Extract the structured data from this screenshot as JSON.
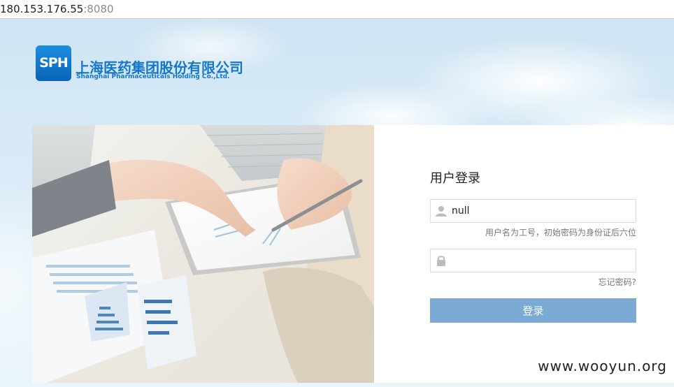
{
  "browser": {
    "address_host": "180.153.176.55",
    "address_port": ":8080"
  },
  "logo": {
    "mark": "SPH",
    "name_cn": "上海医药集团股份有限公司",
    "name_en": "Shanghai Pharmaceuticals Holding Co.,Ltd."
  },
  "login": {
    "title": "用户登录",
    "username_value": "null",
    "username_hint": "用户名为工号，初始密码为身份证后六位",
    "forgot_password": "忘记密码?",
    "submit_label": "登录"
  },
  "watermark": "www.wooyun.org",
  "colors": {
    "brand_blue": "#1477c9",
    "button": "#7aa9d4"
  }
}
